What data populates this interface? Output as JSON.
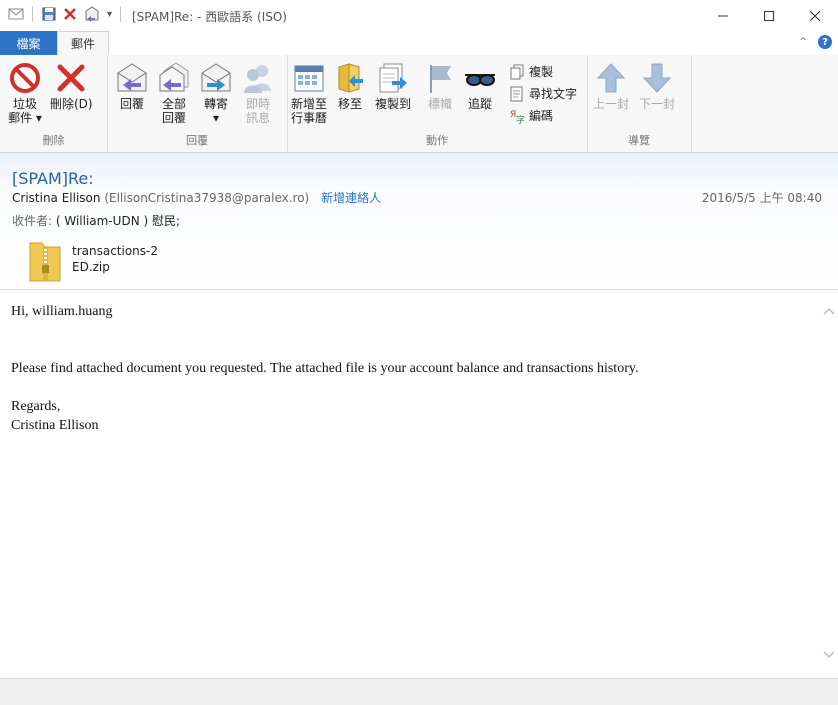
{
  "window": {
    "title": "[SPAM]Re: - 西歐語系 (ISO)",
    "minimize_icon": "minimize-icon",
    "maximize_icon": "maximize-icon",
    "close_icon": "close-icon"
  },
  "tabs": {
    "file": "檔案",
    "message": "郵件"
  },
  "ribbon": {
    "groups": {
      "delete": "刪除",
      "respond": "回覆",
      "actions": "動作",
      "navigate": "導覽"
    },
    "junk_line1": "垃圾",
    "junk_line2": "郵件",
    "delete": "刪除(D)",
    "reply": "回覆",
    "reply_all_line1": "全部",
    "reply_all_line2": "回覆",
    "forward": "轉寄",
    "im_line1": "即時",
    "im_line2": "訊息",
    "add_cal_line1": "新增至",
    "add_cal_line2": "行事曆",
    "move": "移至",
    "copy_to": "複製到",
    "flag": "標幟",
    "watch": "追蹤",
    "copy": "複製",
    "find": "尋找文字",
    "encoding": "編碼",
    "prev": "上一封",
    "next": "下一封"
  },
  "message": {
    "subject": "[SPAM]Re:",
    "sender_name": "Cristina Ellison",
    "sender_email": "(EllisonCristina37938@paralex.ro)",
    "add_contact": "新增連絡人",
    "date": "2016/5/5 上午 08:40",
    "to_label": "收件者:",
    "to_name": "( William-UDN ) 慰民;",
    "attachment_line1": "transactions-2",
    "attachment_line2": "ED.zip",
    "body": {
      "greeting": "Hi, william.huang",
      "line1": "Please find attached document you requested. The attached file is your account balance and transactions history.",
      "regards": "Regards,",
      "signature": "Cristina Ellison"
    }
  },
  "colors": {
    "accent": "#2b74c7",
    "subject": "#2b5fa6"
  }
}
